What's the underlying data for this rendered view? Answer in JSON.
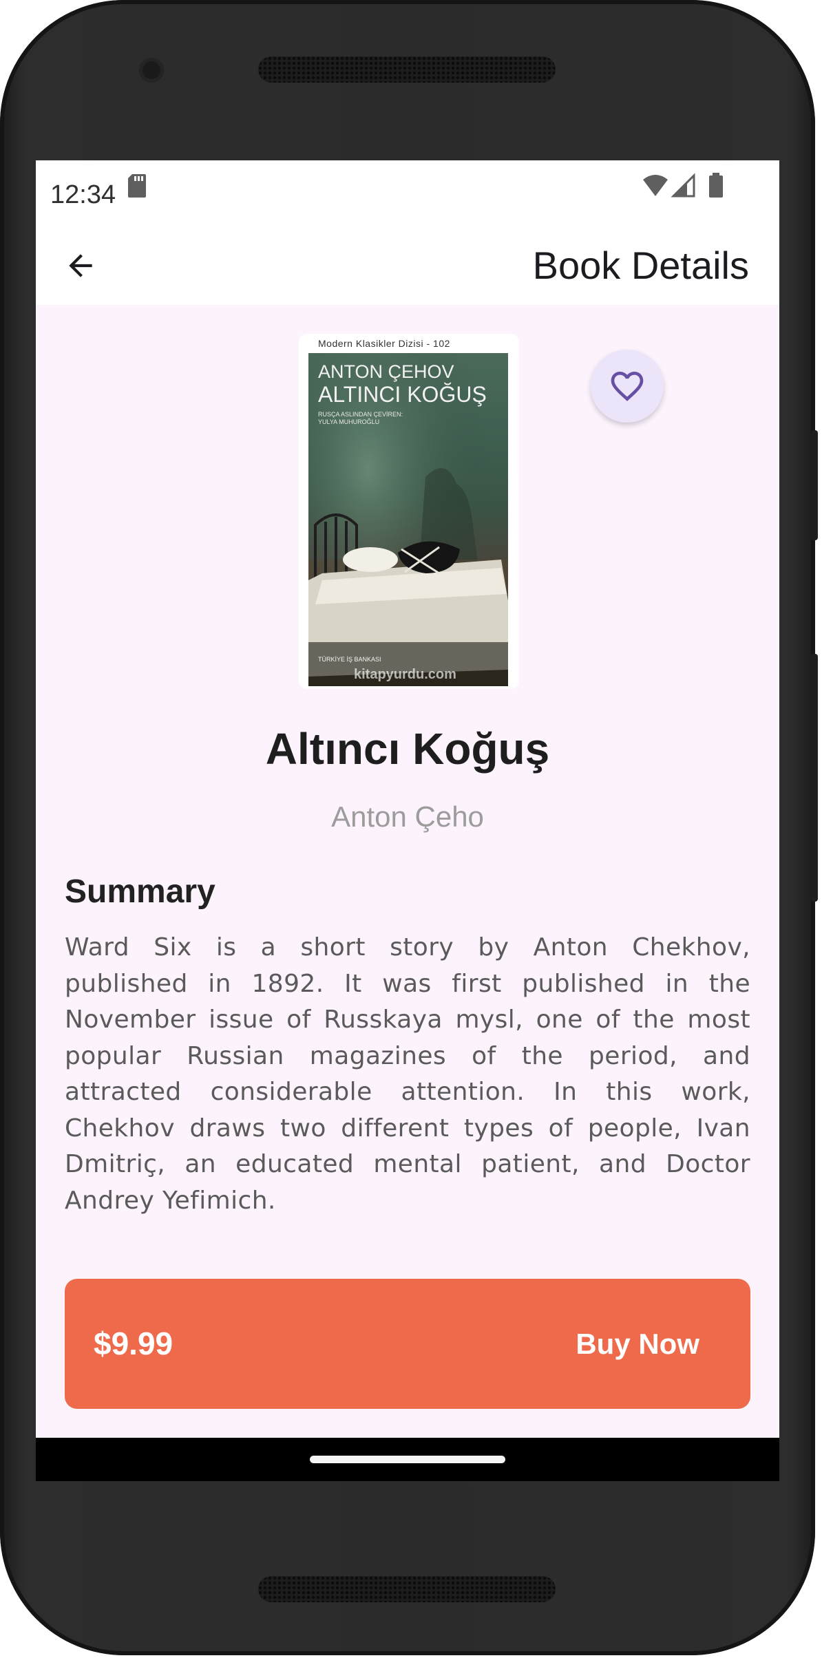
{
  "status_bar": {
    "time": "12:34",
    "icons": [
      "sd-card-icon",
      "wifi-icon",
      "signal-icon",
      "battery-icon"
    ]
  },
  "app_bar": {
    "title": "Book Details",
    "back_icon": "arrow-back-icon"
  },
  "book": {
    "title": "Altıncı Koğuş",
    "author": "Anton Çeho",
    "cover": {
      "series": "Modern Klasikler Dizisi - 102",
      "author": "ANTON ÇEHOV",
      "title": "ALTINCI KOĞUŞ",
      "translator_line1": "RUSÇA ASLINDAN ÇEVİREN:",
      "translator_line2": "YULYA MUHUROĞLU",
      "publisher": "TÜRKİYE İŞ BANKASI",
      "watermark": "kitapyurdu.com"
    },
    "favorite_icon": "heart-outline-icon"
  },
  "summary": {
    "heading": "Summary",
    "text": "Ward Six is a short story by Anton Chekhov, published in 1892. It was first published in the November issue of Russkaya mysl, one of the most popular Russian magazines of the period, and attracted considerable attention. In this work, Chekhov draws two different types of people, Ivan Dmitriç, an educated mental patient, and Doctor Andrey Yefimich."
  },
  "purchase": {
    "price": "$9.99",
    "button_label": "Buy Now"
  },
  "colors": {
    "accent": "#ef6a4b",
    "screen_bg": "#fcf3fd",
    "favorite_bg": "#ece4f9",
    "favorite_icon": "#6750a4"
  }
}
